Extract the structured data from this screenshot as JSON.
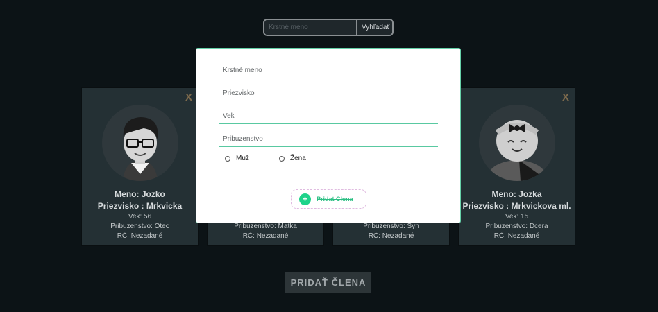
{
  "search": {
    "placeholder": "Krstné meno",
    "button_label": "Vyhľadať"
  },
  "cards": [
    {
      "close": "X",
      "name": "Meno: Jozko",
      "surname": "Priezvisko : Mrkvicka",
      "age": "Vek: 56",
      "relation": "Pribuzenstvo: Otec",
      "rc": "RČ: Nezadané",
      "avatar": "man-glasses"
    },
    {
      "relation": "Pribuzenstvo: Matka",
      "rc": "RČ: Nezadané"
    },
    {
      "relation": "Pribuzenstvo: Syn",
      "rc": "RČ: Nezadané"
    },
    {
      "close": "X",
      "name": "Meno: Jozka",
      "surname": "Priezvisko : Mrkvickova ml.",
      "age": "Vek: 15",
      "relation": "Pribuzenstvo: Dcera",
      "rc": "RČ: Nezadané",
      "avatar": "baby-girl-bow"
    }
  ],
  "modal": {
    "fields": {
      "first_name": "Krstné meno",
      "surname": "Priezvisko",
      "age": "Vek",
      "relation": "Pribuzenstvo"
    },
    "gender": {
      "male": "Muž",
      "female": "Žena"
    },
    "add_label": "Pridat Clena",
    "add_icon": "plus-icon"
  },
  "main_button": "PRIDAŤ  ČLENA",
  "colors": {
    "accent": "#59c9a1",
    "background": "#0c1316",
    "card": "#243034",
    "close": "#7d6a4d"
  }
}
